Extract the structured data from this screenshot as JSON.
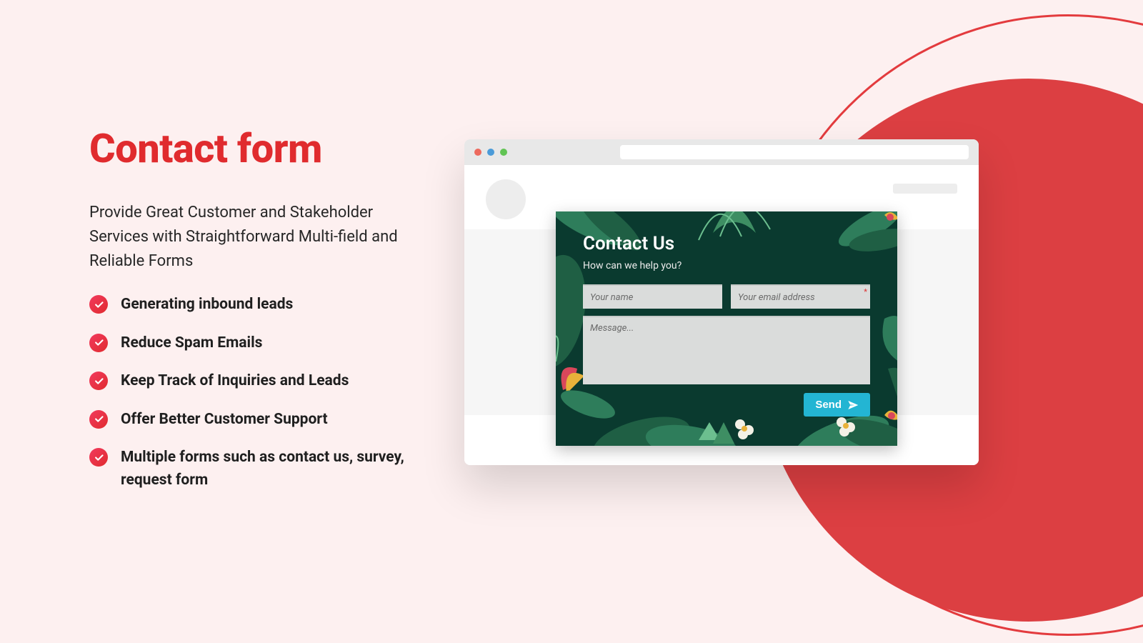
{
  "left": {
    "title": "Contact form",
    "subtitle": "Provide Great Customer and Stakeholder Services with Straightforward Multi-field and Reliable Forms",
    "bullets": [
      "Generating inbound leads",
      "Reduce Spam Emails",
      "Keep Track of Inquiries and Leads",
      "Offer Better Customer Support",
      "Multiple forms such as contact us, survey, request form"
    ]
  },
  "form": {
    "title": "Contact Us",
    "subtitle": "How can we help you?",
    "name_placeholder": "Your name",
    "email_placeholder": "Your email address",
    "message_placeholder": "Message...",
    "send_label": "Send"
  },
  "colors": {
    "accent": "#E02B2E",
    "bg": "#FDF0F0",
    "form_bg": "#0A3A2F",
    "send_btn": "#23B5D3"
  }
}
